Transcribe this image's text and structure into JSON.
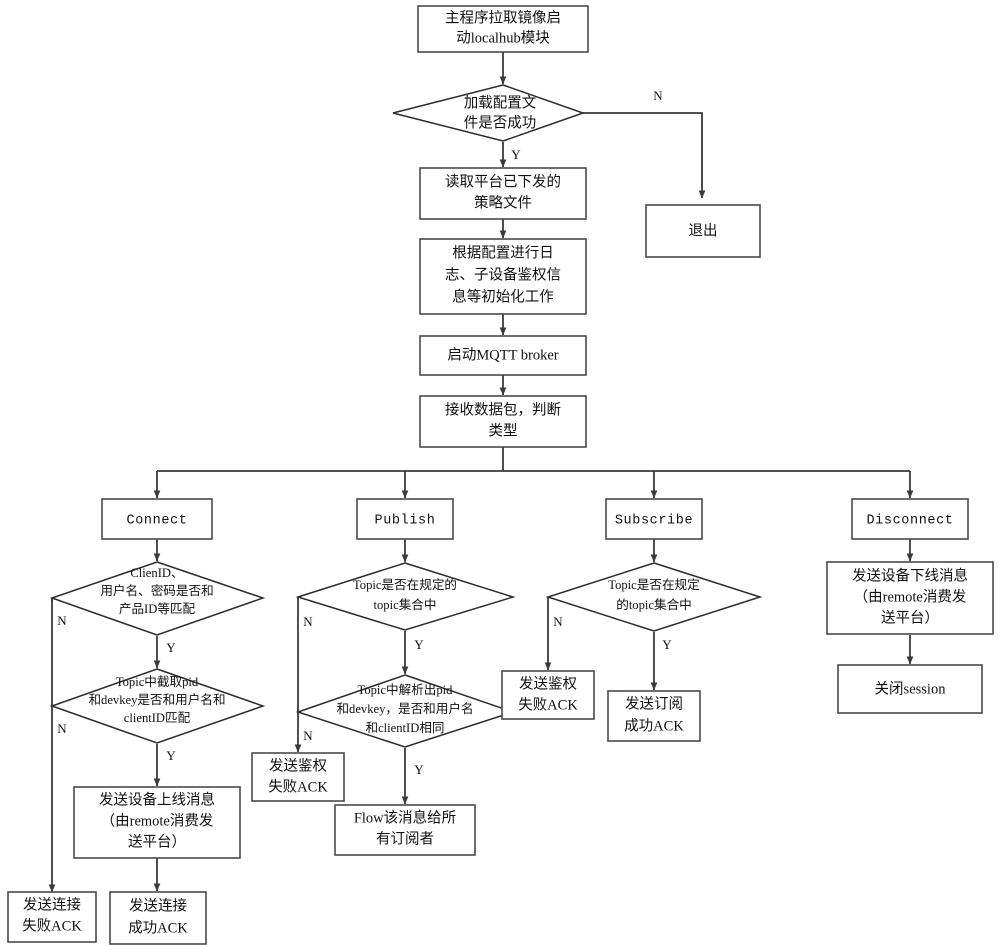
{
  "diagram": {
    "title": "LocalHub MQTT broker startup and packet handling flowchart",
    "colors": {
      "background": "#ffffff",
      "stroke": "#3a3a3a",
      "text": "#111111"
    },
    "nodes": {
      "start": {
        "line1": "主程序拉取镜像启",
        "line2": "动localhub模块"
      },
      "load_config": {
        "line1": "加载配置文",
        "line2": "件是否成功"
      },
      "exit": {
        "line1": "退出"
      },
      "read_policy": {
        "line1": "读取平台已下发的",
        "line2": "策略文件"
      },
      "init_work": {
        "line1": "根据配置进行日",
        "line2": "志、子设备鉴权信",
        "line3": "息等初始化工作"
      },
      "start_broker": {
        "line1": "启动MQTT broker"
      },
      "recv_packet": {
        "line1": "接收数据包，判断",
        "line2": "类型"
      },
      "connect": {
        "line1": "Connect"
      },
      "publish": {
        "line1": "Publish"
      },
      "subscribe": {
        "line1": "Subscribe"
      },
      "disconnect": {
        "line1": "Disconnect"
      },
      "conn_d1": {
        "line1": "ClienID、",
        "line2": "用户名、密码是否和",
        "line3": "产品ID等匹配"
      },
      "conn_d2": {
        "line1": "Topic中截取pid",
        "line2": "和devkey是否和用户名和",
        "line3": "clientID匹配"
      },
      "conn_online": {
        "line1": "发送设备上线消息",
        "line2": "（由remote消费发",
        "line3": "送平台）"
      },
      "conn_fail_ack": {
        "line1": "发送连接",
        "line2": "失败ACK"
      },
      "conn_ok_ack": {
        "line1": "发送连接",
        "line2": "成功ACK"
      },
      "pub_d1": {
        "line1": "Topic是否在规定的",
        "line2": "topic集合中"
      },
      "pub_d2": {
        "line1": "Topic中解析出pid",
        "line2": "和devkey，是否和用户名",
        "line3": "和clientID相同"
      },
      "pub_auth_fail_ack": {
        "line1": "发送鉴权",
        "line2": "失败ACK"
      },
      "pub_flow": {
        "line1": "Flow该消息给所",
        "line2": "有订阅者"
      },
      "sub_d1": {
        "line1": "Topic是否在规定",
        "line2": "的topic集合中"
      },
      "sub_auth_fail_ack": {
        "line1": "发送鉴权",
        "line2": "失败ACK"
      },
      "sub_ok_ack": {
        "line1": "发送订阅",
        "line2": "成功ACK"
      },
      "disc_offline": {
        "line1": "发送设备下线消息",
        "line2": "（由remote消费发",
        "line3": "送平台）"
      },
      "disc_close": {
        "line1": "关闭session"
      }
    },
    "edge_labels": {
      "load_config_n": "N",
      "load_config_y": "Y",
      "conn_d1_n": "N",
      "conn_d1_y": "Y",
      "conn_d2_n": "N",
      "conn_d2_y": "Y",
      "pub_d1_n": "N",
      "pub_d1_y": "Y",
      "pub_d2_n": "N",
      "pub_d2_y": "Y",
      "sub_d1_n": "N",
      "sub_d1_y": "Y"
    }
  }
}
